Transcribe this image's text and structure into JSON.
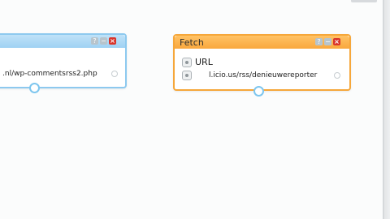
{
  "modules": [
    {
      "id": "blue-module",
      "title": "",
      "url_value": ".nl/wp-commentsrss2.php",
      "controls": {
        "help": "?",
        "minimize": "−",
        "close": "×"
      }
    },
    {
      "id": "fetch-module",
      "title": "Fetch",
      "field_label": "URL",
      "url_value": "l.icio.us/rss/denieuwereporter",
      "controls": {
        "help": "?",
        "minimize": "−",
        "close": "×"
      }
    }
  ],
  "colors": {
    "canvas": "#fbfcfc",
    "blue_border": "#8dc9ef",
    "orange_border": "#f6a73a",
    "close_button": "#d9352b",
    "terminal": "#7ec6ee"
  },
  "icons": [
    "help-icon",
    "minimize-icon",
    "close-icon",
    "expand-icon",
    "remove-icon",
    "terminal-icon"
  ]
}
